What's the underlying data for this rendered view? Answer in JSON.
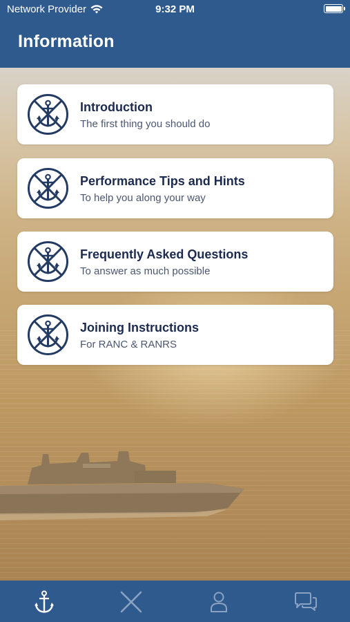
{
  "status": {
    "carrier": "Network Provider",
    "time": "9:32 PM"
  },
  "header": {
    "title": "Information"
  },
  "items": [
    {
      "title": "Introduction",
      "subtitle": "The first thing you should do",
      "icon": "anchor-badge-icon"
    },
    {
      "title": "Performance Tips and Hints",
      "subtitle": "To help you along your way",
      "icon": "anchor-badge-icon"
    },
    {
      "title": "Frequently Asked Questions",
      "subtitle": "To answer as much possible",
      "icon": "anchor-badge-icon"
    },
    {
      "title": "Joining Instructions",
      "subtitle": "For RANC & RANRS",
      "icon": "anchor-badge-icon"
    }
  ],
  "tabbar": {
    "tabs": [
      {
        "icon": "anchor-icon",
        "active": true
      },
      {
        "icon": "crossed-tools-icon",
        "active": false
      },
      {
        "icon": "person-icon",
        "active": false
      },
      {
        "icon": "chat-bubbles-icon",
        "active": false
      }
    ]
  },
  "colors": {
    "navy": "#2f5a8d",
    "card_title": "#1b2a4e",
    "card_sub": "#4b5670",
    "emblem": "#233b63"
  }
}
